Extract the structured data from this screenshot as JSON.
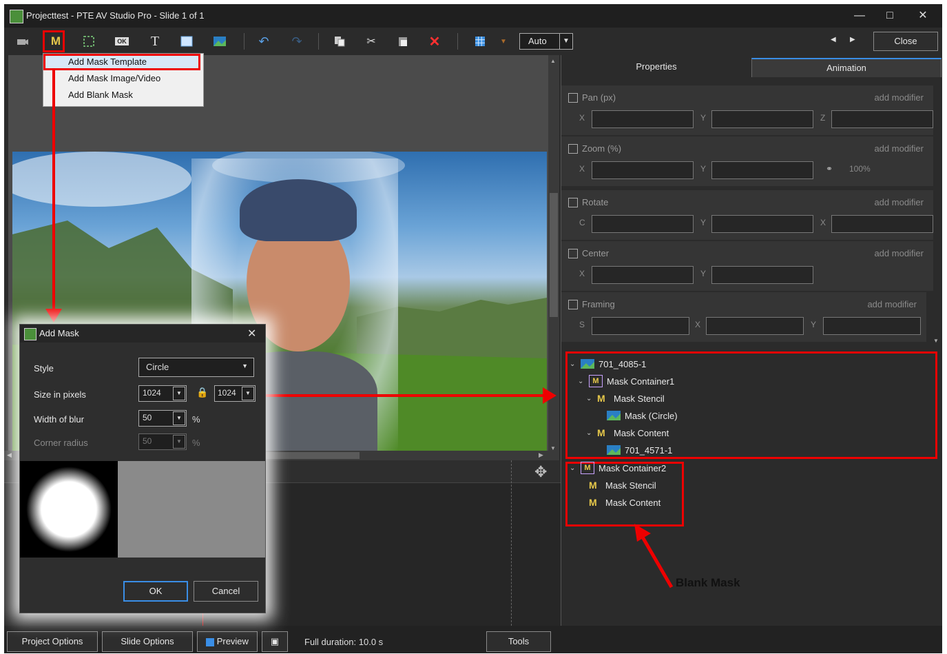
{
  "window": {
    "title": "Projecttest - PTE AV Studio Pro - Slide 1 of 1",
    "close_label": "Close"
  },
  "toolbar": {
    "icons": [
      "camera-icon",
      "mask-icon",
      "frame-icon",
      "ok-icon",
      "text-icon",
      "rectangle-icon",
      "image-icon",
      "undo-icon",
      "redo-icon",
      "copy-icon",
      "cut-icon",
      "paste-icon",
      "delete-icon",
      "grid-icon"
    ],
    "mask_letter": "M",
    "text_letter": "T",
    "ok_letter": "OK",
    "auto_value": "Auto"
  },
  "menu": {
    "items": [
      "Add Mask Template",
      "Add Mask Image/Video",
      "Add Blank Mask"
    ]
  },
  "tabs": {
    "properties": "Properties",
    "animation": "Animation"
  },
  "properties": {
    "groups": [
      {
        "label": "Pan (px)",
        "modifier": "add modifier",
        "axes": [
          "X",
          "Y",
          "Z"
        ]
      },
      {
        "label": "Zoom (%)",
        "modifier": "add modifier",
        "axes": [
          "X",
          "Y"
        ],
        "zoom_value": "100%"
      },
      {
        "label": "Rotate",
        "modifier": "add modifier",
        "axes": [
          "C",
          "Y",
          "X"
        ]
      },
      {
        "label": "Center",
        "modifier": "add modifier",
        "axes": [
          "X",
          "Y"
        ]
      },
      {
        "label": "Framing",
        "modifier": "add modifier",
        "axes": [
          "S",
          "X",
          "Y"
        ]
      }
    ]
  },
  "tree": {
    "nodes": [
      {
        "label": "701_4085-1",
        "icon": "image-icon"
      },
      {
        "label": "Mask Container1",
        "icon": "mask-container-icon"
      },
      {
        "label": "Mask Stencil",
        "icon": "mask-stencil-icon"
      },
      {
        "label": "Mask (Circle)",
        "icon": "image-icon"
      },
      {
        "label": "Mask Content",
        "icon": "mask-content-icon"
      },
      {
        "label": "701_4571-1",
        "icon": "image-icon"
      },
      {
        "label": "Mask Container2",
        "icon": "mask-container-icon"
      },
      {
        "label": "Mask Stencil",
        "icon": "mask-stencil-icon"
      },
      {
        "label": "Mask Content",
        "icon": "mask-content-icon"
      }
    ],
    "annotation": "Blank Mask"
  },
  "dialog": {
    "title": "Add Mask",
    "style_label": "Style",
    "style_value": "Circle",
    "size_label": "Size in pixels",
    "size_w": "1024",
    "size_h": "1024",
    "blur_label": "Width of blur",
    "blur_value": "50",
    "blur_unit": "%",
    "corner_label": "Corner radius",
    "corner_value": "50",
    "corner_unit": "%",
    "ok": "OK",
    "cancel": "Cancel"
  },
  "bottom": {
    "project_options": "Project Options",
    "slide_options": "Slide Options",
    "preview": "Preview",
    "duration": "Full duration: 10.0 s",
    "tools": "Tools"
  },
  "colors": {
    "accent_red": "#e00000",
    "panel": "#2b2b2b",
    "menu_bg": "#f0f0f0"
  }
}
